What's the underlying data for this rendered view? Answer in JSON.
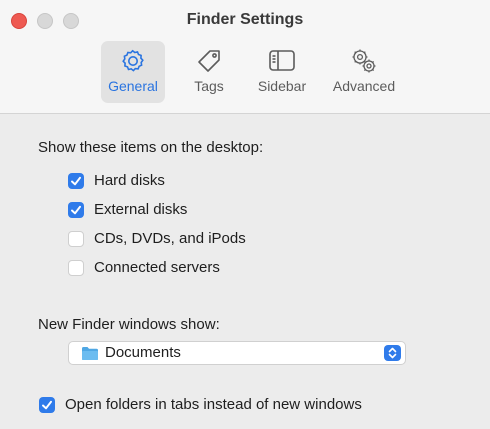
{
  "window": {
    "title": "Finder Settings"
  },
  "tabs": [
    {
      "label": "General",
      "icon": "gear-icon",
      "active": true
    },
    {
      "label": "Tags",
      "icon": "tag-icon",
      "active": false
    },
    {
      "label": "Sidebar",
      "icon": "sidebar-icon",
      "active": false
    },
    {
      "label": "Advanced",
      "icon": "gears-icon",
      "active": false
    }
  ],
  "desktop_section": {
    "label": "Show these items on the desktop:",
    "items": [
      {
        "label": "Hard disks",
        "checked": true
      },
      {
        "label": "External disks",
        "checked": true
      },
      {
        "label": "CDs, DVDs, and iPods",
        "checked": false
      },
      {
        "label": "Connected servers",
        "checked": false
      }
    ]
  },
  "new_window_section": {
    "label": "New Finder windows show:",
    "selected": "Documents",
    "icon": "folder-icon"
  },
  "tabs_option": {
    "label": "Open folders in tabs instead of new windows",
    "checked": true
  },
  "colors": {
    "accent": "#2f7bea",
    "close": "#ee5a52",
    "folder": "#4fa7e4"
  }
}
